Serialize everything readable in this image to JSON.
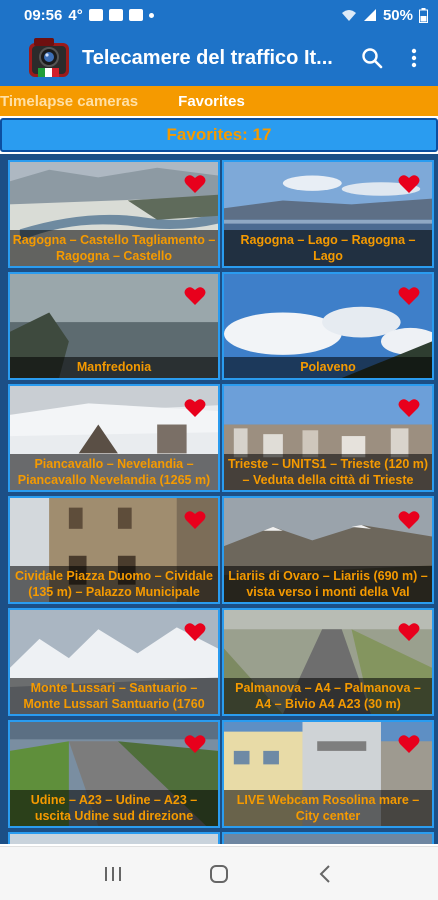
{
  "status_bar": {
    "time": "09:56",
    "temperature": "4°",
    "battery": "50%"
  },
  "app_bar": {
    "title": "Telecamere del traffico It...",
    "icons": {
      "logo": "camera-logo-icon",
      "search": "search-icon",
      "more": "more-vert-icon"
    }
  },
  "tabs": [
    {
      "label": "Timelapse cameras",
      "selected": false
    },
    {
      "label": "Favorites",
      "selected": true
    }
  ],
  "colors": {
    "primary": "#1e73c8",
    "accent": "#f59a00",
    "header": "#2a9cf0",
    "grid_bg": "#1c4f86",
    "heart": "#e8001c"
  },
  "favorites_header": "Favorites: 17",
  "cameras": [
    {
      "caption": "Ragogna – Castello Tagliamento – Ragogna – Castello",
      "favorite": true
    },
    {
      "caption": "Ragogna – Lago – Ragogna – Lago",
      "favorite": true
    },
    {
      "caption": "Manfredonia",
      "favorite": true
    },
    {
      "caption": "Polaveno",
      "favorite": true
    },
    {
      "caption": "Piancavallo – Nevelandia – Piancavallo Nevelandia (1265 m)",
      "favorite": true
    },
    {
      "caption": "Trieste – UNITS1 – Trieste (120 m) – Veduta della città di Trieste",
      "favorite": true
    },
    {
      "caption": "Cividale Piazza Duomo – Cividale (135 m) – Palazzo Municipale",
      "favorite": true
    },
    {
      "caption": "Liariis di Ovaro – Liariis (690 m) – vista verso i monti della Val",
      "favorite": true
    },
    {
      "caption": "Monte Lussari – Santuario – Monte Lussari Santuario (1760",
      "favorite": true
    },
    {
      "caption": "Palmanova – A4 – Palmanova – A4 – Bivio A4 A23 (30 m)",
      "favorite": true
    },
    {
      "caption": "Udine – A23 – Udine – A23 – uscita Udine sud direzione",
      "favorite": true
    },
    {
      "caption": "LIVE Webcam Rosolina mare – City center",
      "favorite": true
    }
  ],
  "nav_bar": {
    "recents": "recents-icon",
    "home": "home-icon",
    "back": "back-icon"
  }
}
